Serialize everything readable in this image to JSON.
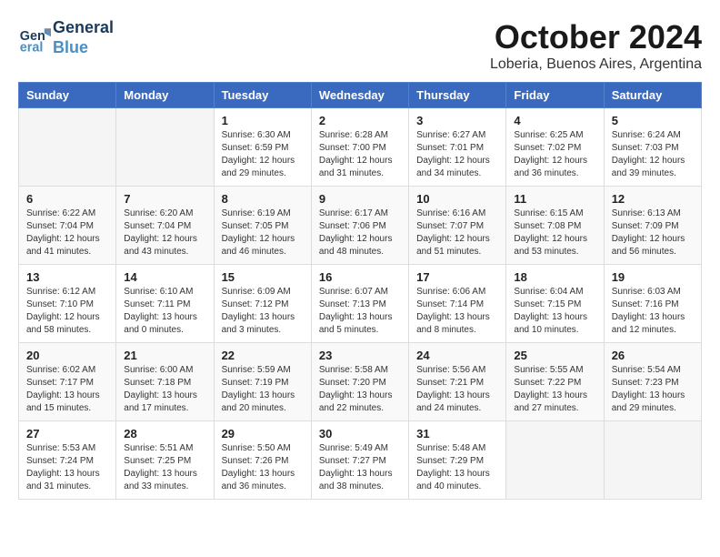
{
  "header": {
    "logo_line1": "General",
    "logo_line2": "Blue",
    "month": "October 2024",
    "location": "Loberia, Buenos Aires, Argentina"
  },
  "weekdays": [
    "Sunday",
    "Monday",
    "Tuesday",
    "Wednesday",
    "Thursday",
    "Friday",
    "Saturday"
  ],
  "weeks": [
    [
      {
        "day": "",
        "details": ""
      },
      {
        "day": "",
        "details": ""
      },
      {
        "day": "1",
        "details": "Sunrise: 6:30 AM\nSunset: 6:59 PM\nDaylight: 12 hours\nand 29 minutes."
      },
      {
        "day": "2",
        "details": "Sunrise: 6:28 AM\nSunset: 7:00 PM\nDaylight: 12 hours\nand 31 minutes."
      },
      {
        "day": "3",
        "details": "Sunrise: 6:27 AM\nSunset: 7:01 PM\nDaylight: 12 hours\nand 34 minutes."
      },
      {
        "day": "4",
        "details": "Sunrise: 6:25 AM\nSunset: 7:02 PM\nDaylight: 12 hours\nand 36 minutes."
      },
      {
        "day": "5",
        "details": "Sunrise: 6:24 AM\nSunset: 7:03 PM\nDaylight: 12 hours\nand 39 minutes."
      }
    ],
    [
      {
        "day": "6",
        "details": "Sunrise: 6:22 AM\nSunset: 7:04 PM\nDaylight: 12 hours\nand 41 minutes."
      },
      {
        "day": "7",
        "details": "Sunrise: 6:20 AM\nSunset: 7:04 PM\nDaylight: 12 hours\nand 43 minutes."
      },
      {
        "day": "8",
        "details": "Sunrise: 6:19 AM\nSunset: 7:05 PM\nDaylight: 12 hours\nand 46 minutes."
      },
      {
        "day": "9",
        "details": "Sunrise: 6:17 AM\nSunset: 7:06 PM\nDaylight: 12 hours\nand 48 minutes."
      },
      {
        "day": "10",
        "details": "Sunrise: 6:16 AM\nSunset: 7:07 PM\nDaylight: 12 hours\nand 51 minutes."
      },
      {
        "day": "11",
        "details": "Sunrise: 6:15 AM\nSunset: 7:08 PM\nDaylight: 12 hours\nand 53 minutes."
      },
      {
        "day": "12",
        "details": "Sunrise: 6:13 AM\nSunset: 7:09 PM\nDaylight: 12 hours\nand 56 minutes."
      }
    ],
    [
      {
        "day": "13",
        "details": "Sunrise: 6:12 AM\nSunset: 7:10 PM\nDaylight: 12 hours\nand 58 minutes."
      },
      {
        "day": "14",
        "details": "Sunrise: 6:10 AM\nSunset: 7:11 PM\nDaylight: 13 hours\nand 0 minutes."
      },
      {
        "day": "15",
        "details": "Sunrise: 6:09 AM\nSunset: 7:12 PM\nDaylight: 13 hours\nand 3 minutes."
      },
      {
        "day": "16",
        "details": "Sunrise: 6:07 AM\nSunset: 7:13 PM\nDaylight: 13 hours\nand 5 minutes."
      },
      {
        "day": "17",
        "details": "Sunrise: 6:06 AM\nSunset: 7:14 PM\nDaylight: 13 hours\nand 8 minutes."
      },
      {
        "day": "18",
        "details": "Sunrise: 6:04 AM\nSunset: 7:15 PM\nDaylight: 13 hours\nand 10 minutes."
      },
      {
        "day": "19",
        "details": "Sunrise: 6:03 AM\nSunset: 7:16 PM\nDaylight: 13 hours\nand 12 minutes."
      }
    ],
    [
      {
        "day": "20",
        "details": "Sunrise: 6:02 AM\nSunset: 7:17 PM\nDaylight: 13 hours\nand 15 minutes."
      },
      {
        "day": "21",
        "details": "Sunrise: 6:00 AM\nSunset: 7:18 PM\nDaylight: 13 hours\nand 17 minutes."
      },
      {
        "day": "22",
        "details": "Sunrise: 5:59 AM\nSunset: 7:19 PM\nDaylight: 13 hours\nand 20 minutes."
      },
      {
        "day": "23",
        "details": "Sunrise: 5:58 AM\nSunset: 7:20 PM\nDaylight: 13 hours\nand 22 minutes."
      },
      {
        "day": "24",
        "details": "Sunrise: 5:56 AM\nSunset: 7:21 PM\nDaylight: 13 hours\nand 24 minutes."
      },
      {
        "day": "25",
        "details": "Sunrise: 5:55 AM\nSunset: 7:22 PM\nDaylight: 13 hours\nand 27 minutes."
      },
      {
        "day": "26",
        "details": "Sunrise: 5:54 AM\nSunset: 7:23 PM\nDaylight: 13 hours\nand 29 minutes."
      }
    ],
    [
      {
        "day": "27",
        "details": "Sunrise: 5:53 AM\nSunset: 7:24 PM\nDaylight: 13 hours\nand 31 minutes."
      },
      {
        "day": "28",
        "details": "Sunrise: 5:51 AM\nSunset: 7:25 PM\nDaylight: 13 hours\nand 33 minutes."
      },
      {
        "day": "29",
        "details": "Sunrise: 5:50 AM\nSunset: 7:26 PM\nDaylight: 13 hours\nand 36 minutes."
      },
      {
        "day": "30",
        "details": "Sunrise: 5:49 AM\nSunset: 7:27 PM\nDaylight: 13 hours\nand 38 minutes."
      },
      {
        "day": "31",
        "details": "Sunrise: 5:48 AM\nSunset: 7:29 PM\nDaylight: 13 hours\nand 40 minutes."
      },
      {
        "day": "",
        "details": ""
      },
      {
        "day": "",
        "details": ""
      }
    ]
  ]
}
